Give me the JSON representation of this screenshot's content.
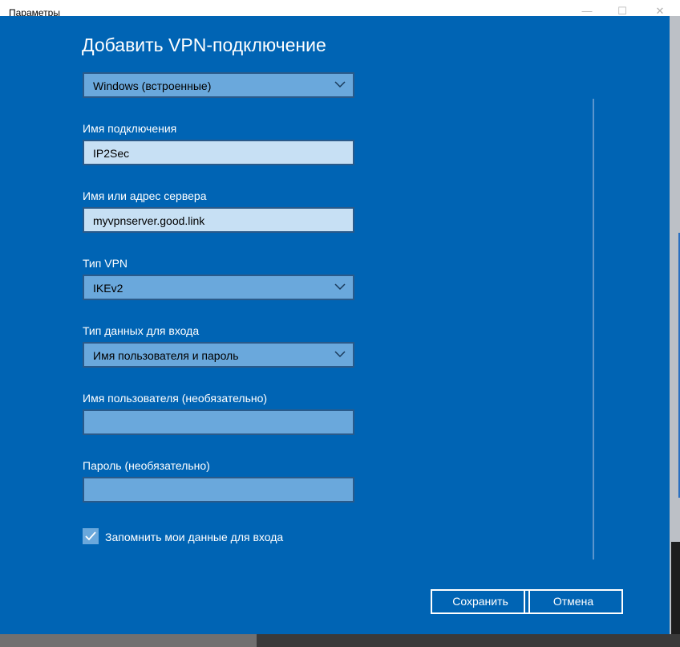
{
  "window": {
    "title": "Параметры",
    "controls": {
      "minimize": "—",
      "maximize": "☐",
      "close": "✕"
    }
  },
  "dialog": {
    "title": "Добавить VPN-подключение",
    "provider": {
      "value": "Windows (встроенные)"
    },
    "connection_name": {
      "label": "Имя подключения",
      "value": "IP2Sec"
    },
    "server": {
      "label": "Имя или адрес сервера",
      "value": "myvpnserver.good.link"
    },
    "vpn_type": {
      "label": "Тип VPN",
      "value": "IKEv2"
    },
    "signin_type": {
      "label": "Тип данных для входа",
      "value": "Имя пользователя и пароль"
    },
    "username": {
      "label": "Имя пользователя (необязательно)",
      "value": ""
    },
    "password": {
      "label": "Пароль (необязательно)",
      "value": ""
    },
    "remember": {
      "label": "Запомнить мои данные для входа",
      "checked": true
    },
    "buttons": {
      "save": "Сохранить",
      "cancel": "Отмена"
    }
  },
  "colors": {
    "dialog_background": "#0064b4",
    "input_filled": "#c7e0f4",
    "input_empty": "#6aa8dc"
  }
}
